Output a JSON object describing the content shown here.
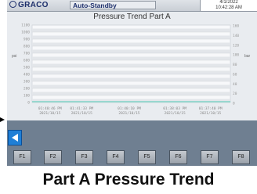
{
  "header": {
    "brand": "GRACO",
    "status": "Auto-Standby",
    "date": "4/1/2022",
    "time": "10:42:28 AM"
  },
  "chart_data": {
    "type": "line",
    "title": "Pressure Trend Part A",
    "left_unit": "psi",
    "right_unit": "bar",
    "y_left_ticks": [
      "1100",
      "1000",
      "900",
      "800",
      "700",
      "600",
      "500",
      "400",
      "300",
      "200",
      "100",
      "0"
    ],
    "y_right_ticks": [
      "160",
      "140",
      "120",
      "100",
      "80",
      "60",
      "40",
      "20",
      "0"
    ],
    "x_ticks": [
      {
        "time": "01:40:46 PM",
        "date": "2021/10/15"
      },
      {
        "time": "01:41:33 PM",
        "date": "2021/10/15"
      },
      {
        "time": "01:40:10 PM",
        "date": "2021/10/15"
      },
      {
        "time": "01:38:03 PM",
        "date": "2021/10/15"
      },
      {
        "time": "01:37:40 PM",
        "date": "2021/10/15"
      }
    ],
    "series": [
      {
        "color": "#7fd4c8",
        "value_psi": 0
      }
    ],
    "ylim_left": [
      0,
      1150
    ],
    "ylim_right": [
      0,
      160
    ],
    "grid": true
  },
  "nav": {
    "back_icon": "left-arrow-icon"
  },
  "function_keys": [
    "F1",
    "F2",
    "F3",
    "F4",
    "F5",
    "F6",
    "F7",
    "F8"
  ],
  "caption": "Part A Pressure Trend",
  "colors": {
    "brand": "#1d2f6b",
    "back_button": "#1f7fd6",
    "frame": "#6f7f91"
  }
}
